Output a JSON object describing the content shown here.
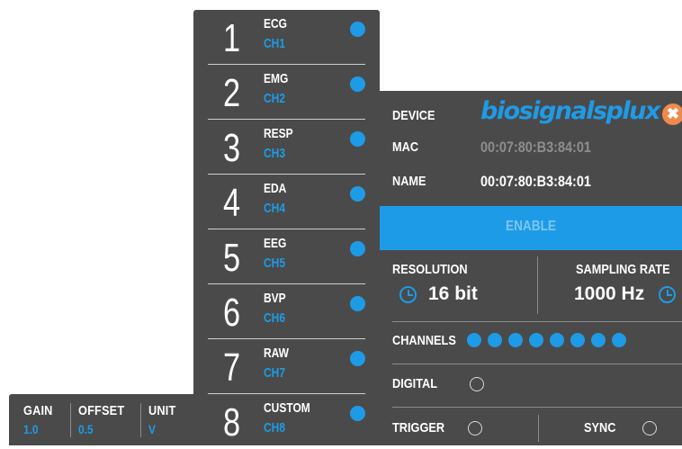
{
  "colors": {
    "panel_bg": "#4a4a4a",
    "accent": "#1e9be6",
    "close": "#f08a4b",
    "muted_text": "#8e8e8e"
  },
  "gain_tab": {
    "gain_label": "GAIN",
    "gain_value": "1.0",
    "offset_label": "OFFSET",
    "offset_value": "0.5",
    "unit_label": "UNIT",
    "unit_value": "V"
  },
  "channels": [
    {
      "number": "1",
      "name": "ECG",
      "id": "CH1",
      "active": true
    },
    {
      "number": "2",
      "name": "EMG",
      "id": "CH2",
      "active": true
    },
    {
      "number": "3",
      "name": "RESP",
      "id": "CH3",
      "active": true
    },
    {
      "number": "4",
      "name": "EDA",
      "id": "CH4",
      "active": true
    },
    {
      "number": "5",
      "name": "EEG",
      "id": "CH5",
      "active": true
    },
    {
      "number": "6",
      "name": "BVP",
      "id": "CH6",
      "active": true
    },
    {
      "number": "7",
      "name": "RAW",
      "id": "CH7",
      "active": true
    },
    {
      "number": "8",
      "name": "CUSTOM",
      "id": "CH8",
      "active": true
    }
  ],
  "device": {
    "device_label": "DEVICE",
    "logo_text": "biosignalsplux",
    "close_icon": "close-icon",
    "mac_label": "MAC",
    "mac_value": "00:07:80:B3:84:01",
    "name_label": "NAME",
    "name_value": "00:07:80:B3:84:01",
    "enable_label": "ENABLE",
    "resolution_label": "RESOLUTION",
    "resolution_value": "16 bit",
    "sampling_rate_label": "SAMPLING RATE",
    "sampling_rate_value": "1000 Hz",
    "channels_label": "CHANNELS",
    "active_channel_count": 8,
    "digital_label": "DIGITAL",
    "trigger_label": "TRIGGER",
    "sync_label": "SYNC"
  }
}
